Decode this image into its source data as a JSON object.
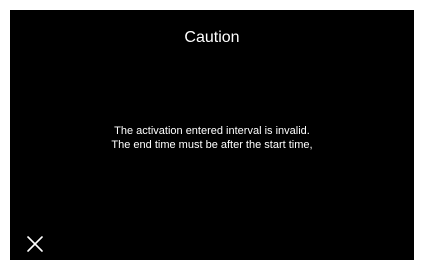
{
  "dialog": {
    "title": "Caution",
    "message_lines": [
      "The activation entered interval is invalid.",
      "The end time must be after the start time,"
    ],
    "close_icon": "close-icon"
  },
  "colors": {
    "background": "#000000",
    "text": "#ffffff"
  }
}
